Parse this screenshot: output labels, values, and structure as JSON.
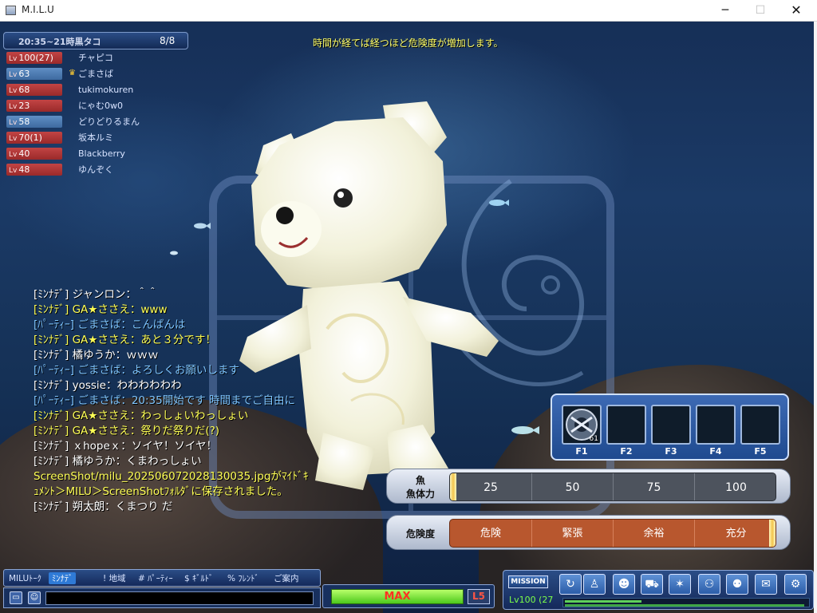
{
  "window": {
    "title": "M.I.L.U",
    "minimize_glyph": "─",
    "maximize_glyph": "☐",
    "close_glyph": "✕"
  },
  "notice": "時間が経てば経つほど危険度が増加します。",
  "party": {
    "time": "20:35~21時黒タコ",
    "count": "8/8",
    "members": [
      {
        "level": "100(27)",
        "name": "チャピコ",
        "color": "red"
      },
      {
        "level": "63",
        "name": "ごまさば",
        "color": "blue",
        "leader": true
      },
      {
        "level": "68",
        "name": "tukimokuren",
        "color": "red"
      },
      {
        "level": "23",
        "name": "にゃむ0w0",
        "color": "red"
      },
      {
        "level": "58",
        "name": "どりどりるまん",
        "color": "blue"
      },
      {
        "level": "70(1)",
        "name": "坂本ルミ",
        "color": "red"
      },
      {
        "level": "40",
        "name": "Blackberry",
        "color": "red"
      },
      {
        "level": "48",
        "name": "ゆんぞく",
        "color": "red"
      }
    ],
    "lv_prefix": "Lv",
    "leader_icon": "crown-icon"
  },
  "chat": [
    {
      "text": "[ﾐﾝﾅﾃﾞ] ジャンロン：＾＾",
      "color": "white"
    },
    {
      "text": "[ﾐﾝﾅﾃﾞ] GA★ささえ：www",
      "color": "yellow"
    },
    {
      "text": "[ﾊﾟｰﾃｨｰ] ごまさば：こんばんは",
      "color": "cyan"
    },
    {
      "text": "[ﾐﾝﾅﾃﾞ] GA★ささえ：あと３分です！",
      "color": "yellow"
    },
    {
      "text": "[ﾐﾝﾅﾃﾞ] 橘ゆうか：ｗｗｗ",
      "color": "white"
    },
    {
      "text": "[ﾊﾟｰﾃｨｰ] ごまさば：よろしくお願いします",
      "color": "cyan"
    },
    {
      "text": "[ﾐﾝﾅﾃﾞ] yossie：わわわわわわ",
      "color": "white"
    },
    {
      "text": "[ﾊﾟｰﾃｨｰ] ごまさば：20:35開始です 時間までご自由に",
      "color": "cyan"
    },
    {
      "text": "[ﾐﾝﾅﾃﾞ] GA★ささえ：わっしょいわっしょい",
      "color": "yellow"
    },
    {
      "text": "[ﾐﾝﾅﾃﾞ] GA★ささえ：祭りだ祭りだ(?)",
      "color": "yellow"
    },
    {
      "text": "[ﾐﾝﾅﾃﾞ] ｘhopeｘ：ソイヤ！ソイヤ！",
      "color": "white"
    },
    {
      "text": "[ﾐﾝﾅﾃﾞ] 橘ゆうか：くまわっしょい",
      "color": "white"
    },
    {
      "text": "ScreenShot/milu_202506072028130035.jpgがﾏｲﾄﾞｷｭﾒﾝﾄ＞MILU＞ScreenShotﾌｫﾙﾀﾞに保存されました。",
      "color": "yellow"
    },
    {
      "text": "[ﾐﾝﾅﾃﾞ] 朔太朗：くまつり だ",
      "color": "white"
    }
  ],
  "slots": {
    "keys": [
      "F1",
      "F2",
      "F3",
      "F4",
      "F5"
    ],
    "first_count": "61",
    "first_icon": "lure-skill-icon"
  },
  "fish_gauge": {
    "label_line1": "魚",
    "label_line2": "魚体力",
    "ticks": [
      "25",
      "50",
      "75",
      "100"
    ],
    "marker_fraction": 0.0
  },
  "danger_gauge": {
    "label": "危険度",
    "ticks": [
      "危険",
      "緊張",
      "余裕",
      "充分"
    ],
    "marker_fraction": 1.0
  },
  "chat_tabs": [
    "MILUﾄｰｸ",
    "ﾐﾝﾅﾃﾞ",
    "! 地域",
    "# ﾊﾟｰﾃｨｰ",
    "$ ｷﾞﾙﾄﾞ",
    "% ﾌﾚﾝﾄﾞ",
    "ご案内"
  ],
  "chat_input": {
    "value": ""
  },
  "max_gauge": {
    "label": "MAX",
    "level_tag": "L5",
    "fill_fraction": 1.0
  },
  "menu": {
    "mission_label": "MISSION",
    "player_level": "Lv100 (27",
    "icons": [
      "return-icon",
      "character-icon",
      "avatar-icon",
      "vehicle-icon",
      "skill-burst-icon",
      "party-add-icon",
      "community-icon",
      "chat-bubble-icon",
      "settings-gear-icon"
    ]
  },
  "colors": {
    "accent": "#2b4d86",
    "party_red": "#c24444",
    "party_blue": "#5f8ec4",
    "notice_yellow": "#ffff66",
    "danger_orange": "#b8572e"
  }
}
